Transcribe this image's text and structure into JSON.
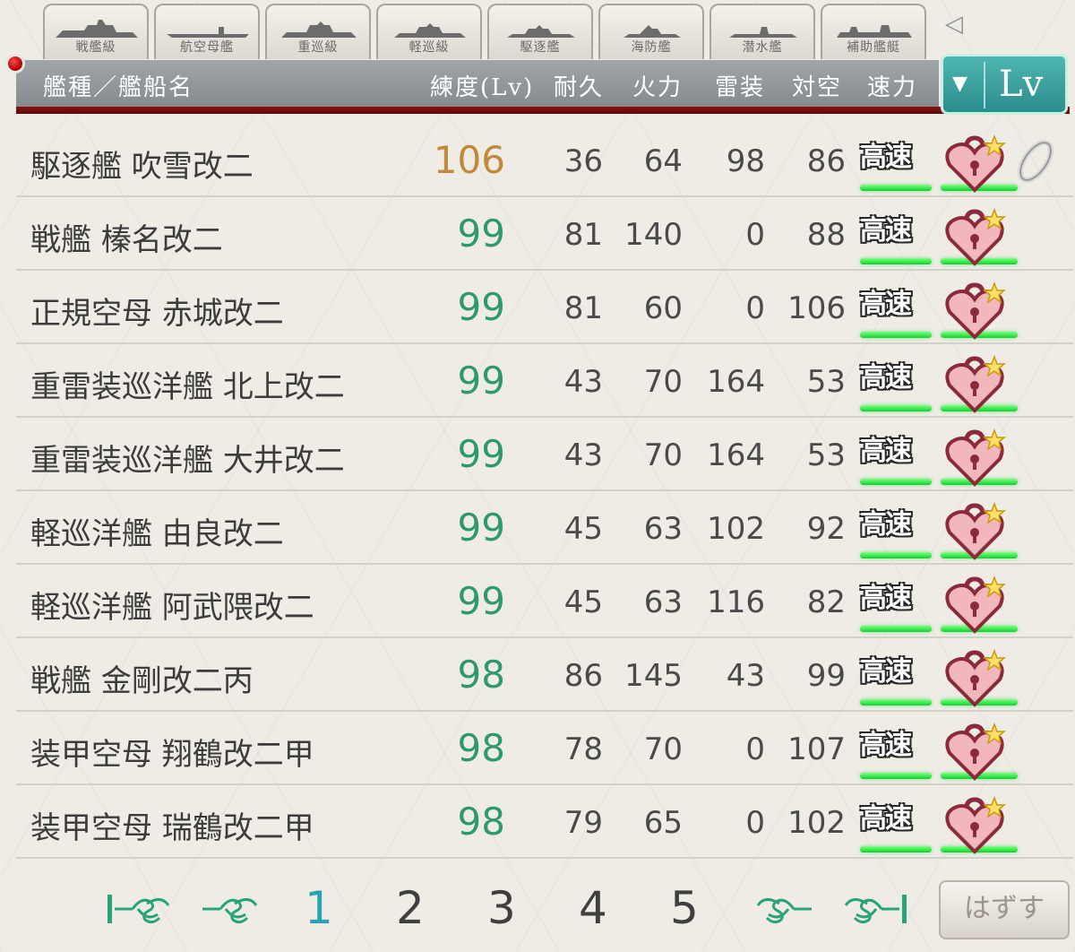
{
  "tabs": [
    {
      "label": "戦艦級"
    },
    {
      "label": "航空母艦"
    },
    {
      "label": "重巡級"
    },
    {
      "label": "軽巡級"
    },
    {
      "label": "駆逐艦"
    },
    {
      "label": "海防艦"
    },
    {
      "label": "潜水艦"
    },
    {
      "label": "補助艦艇"
    }
  ],
  "header": {
    "col_name": "艦種／艦船名",
    "col_level": "練度(Lv)",
    "col_hp": "耐久",
    "col_firepower": "火力",
    "col_torpedo": "雷装",
    "col_antiair": "対空",
    "col_speed": "速力",
    "sort_label": "Lv",
    "sort_arrow": "▼"
  },
  "collapse_icon": "◁",
  "ships": [
    {
      "name": "駆逐艦 吹雪改二",
      "level": "106",
      "hp": "36",
      "firepower": "64",
      "torpedo": "98",
      "antiair": "86",
      "speed": "高速",
      "married": true
    },
    {
      "name": "戦艦 榛名改二",
      "level": "99",
      "hp": "81",
      "firepower": "140",
      "torpedo": "0",
      "antiair": "88",
      "speed": "高速",
      "married": false
    },
    {
      "name": "正規空母 赤城改二",
      "level": "99",
      "hp": "81",
      "firepower": "60",
      "torpedo": "0",
      "antiair": "106",
      "speed": "高速",
      "married": false
    },
    {
      "name": "重雷装巡洋艦 北上改二",
      "level": "99",
      "hp": "43",
      "firepower": "70",
      "torpedo": "164",
      "antiair": "53",
      "speed": "高速",
      "married": false
    },
    {
      "name": "重雷装巡洋艦 大井改二",
      "level": "99",
      "hp": "43",
      "firepower": "70",
      "torpedo": "164",
      "antiair": "53",
      "speed": "高速",
      "married": false
    },
    {
      "name": "軽巡洋艦 由良改二",
      "level": "99",
      "hp": "45",
      "firepower": "63",
      "torpedo": "102",
      "antiair": "92",
      "speed": "高速",
      "married": false
    },
    {
      "name": "軽巡洋艦 阿武隈改二",
      "level": "99",
      "hp": "45",
      "firepower": "63",
      "torpedo": "116",
      "antiair": "82",
      "speed": "高速",
      "married": false
    },
    {
      "name": "戦艦 金剛改二丙",
      "level": "98",
      "hp": "86",
      "firepower": "145",
      "torpedo": "43",
      "antiair": "99",
      "speed": "高速",
      "married": false
    },
    {
      "name": "装甲空母 翔鶴改二甲",
      "level": "98",
      "hp": "78",
      "firepower": "70",
      "torpedo": "0",
      "antiair": "107",
      "speed": "高速",
      "married": false
    },
    {
      "name": "装甲空母 瑞鶴改二甲",
      "level": "98",
      "hp": "79",
      "firepower": "65",
      "torpedo": "0",
      "antiair": "102",
      "speed": "高速",
      "married": false
    }
  ],
  "pagination": {
    "pages": [
      "1",
      "2",
      "3",
      "4",
      "5"
    ],
    "current": "1"
  },
  "unequip_button": "はずす",
  "colors": {
    "level_normal": "#2e9a6a",
    "level_married": "#c1893a",
    "active_page": "#2aa3b0",
    "header_bar": "#8f9498",
    "sort_button": "#2b8d8c"
  }
}
